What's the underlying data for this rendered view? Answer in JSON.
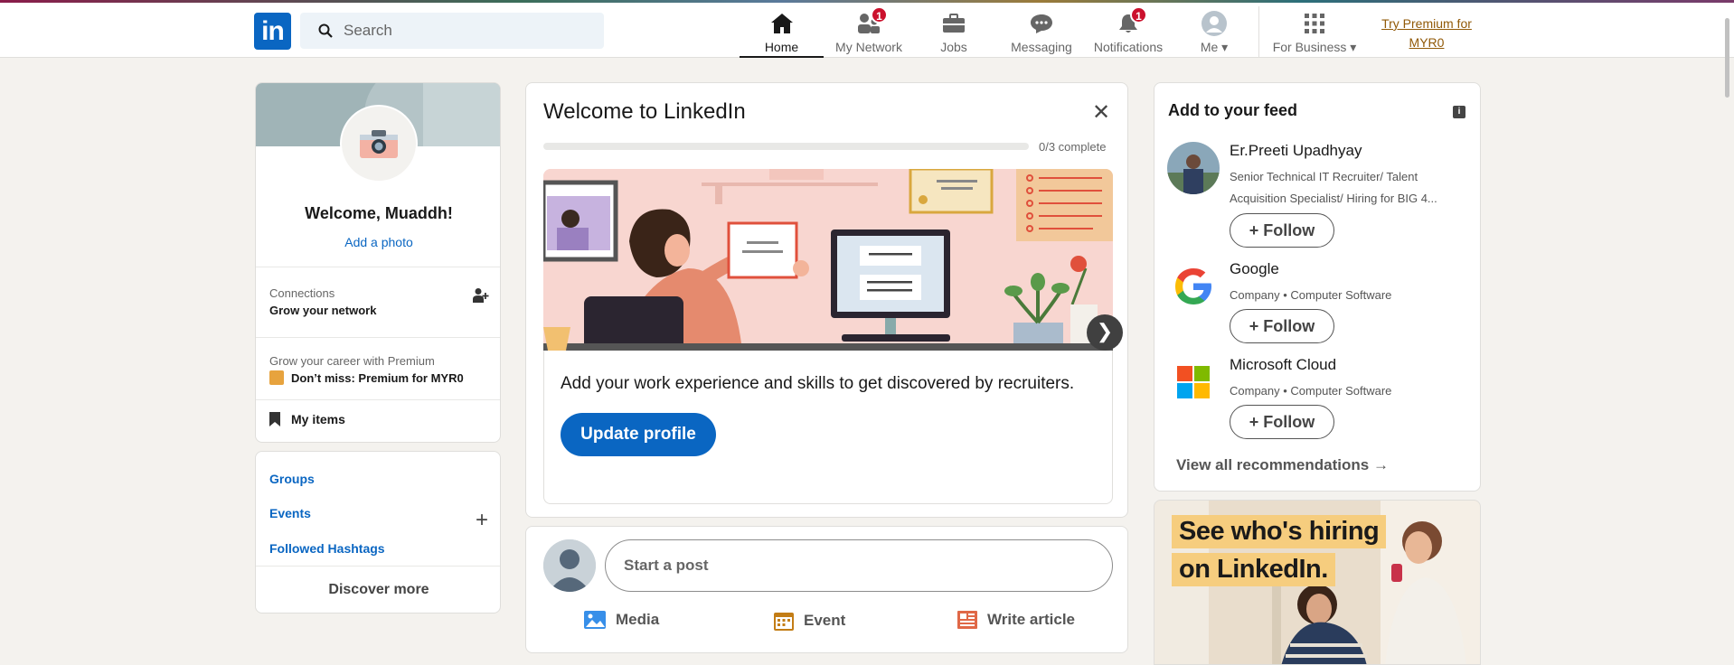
{
  "nav": {
    "logo": "in",
    "search_placeholder": "Search",
    "items": [
      {
        "label": "Home",
        "badge": null
      },
      {
        "label": "My Network",
        "badge": "1"
      },
      {
        "label": "Jobs",
        "badge": null
      },
      {
        "label": "Messaging",
        "badge": null
      },
      {
        "label": "Notifications",
        "badge": "1"
      },
      {
        "label": "Me",
        "badge": null
      },
      {
        "label": "For Business",
        "badge": null
      }
    ],
    "premium": "Try Premium for MYR0"
  },
  "profile": {
    "welcome": "Welcome, Muaddh!",
    "add_photo": "Add a photo",
    "connections_label": "Connections",
    "connections_sub": "Grow your network",
    "premium_label": "Grow your career with Premium",
    "premium_sub": "Don’t miss: Premium for MYR0",
    "my_items": "My items"
  },
  "groups": {
    "links": [
      "Groups",
      "Events",
      "Followed Hashtags"
    ],
    "discover": "Discover more"
  },
  "welcome_card": {
    "title": "Welcome to LinkedIn",
    "progress_text": "0/3 complete",
    "progress_fraction": 0,
    "body": "Add your work experience and skills to get discovered by recruiters.",
    "button": "Update profile"
  },
  "post": {
    "placeholder": "Start a post",
    "actions": [
      "Media",
      "Event",
      "Write article"
    ]
  },
  "feed": {
    "title": "Add to your feed",
    "recs": [
      {
        "name": "Er.Preeti Upadhyay",
        "desc": "Senior Technical IT Recruiter/ Talent Acquisition Specialist/ Hiring for BIG 4...",
        "button": "Follow"
      },
      {
        "name": "Google",
        "desc": "Company • Computer Software",
        "button": "Follow"
      },
      {
        "name": "Microsoft Cloud",
        "desc": "Company • Computer Software",
        "button": "Follow"
      }
    ],
    "view_all": "View all recommendations"
  },
  "ad": {
    "line1": "See who's hiring",
    "line2": "on LinkedIn."
  },
  "colors": {
    "brand": "#0a66c2",
    "badge": "#cb112d",
    "premium": "#915907",
    "background": "#f4f2ee"
  }
}
